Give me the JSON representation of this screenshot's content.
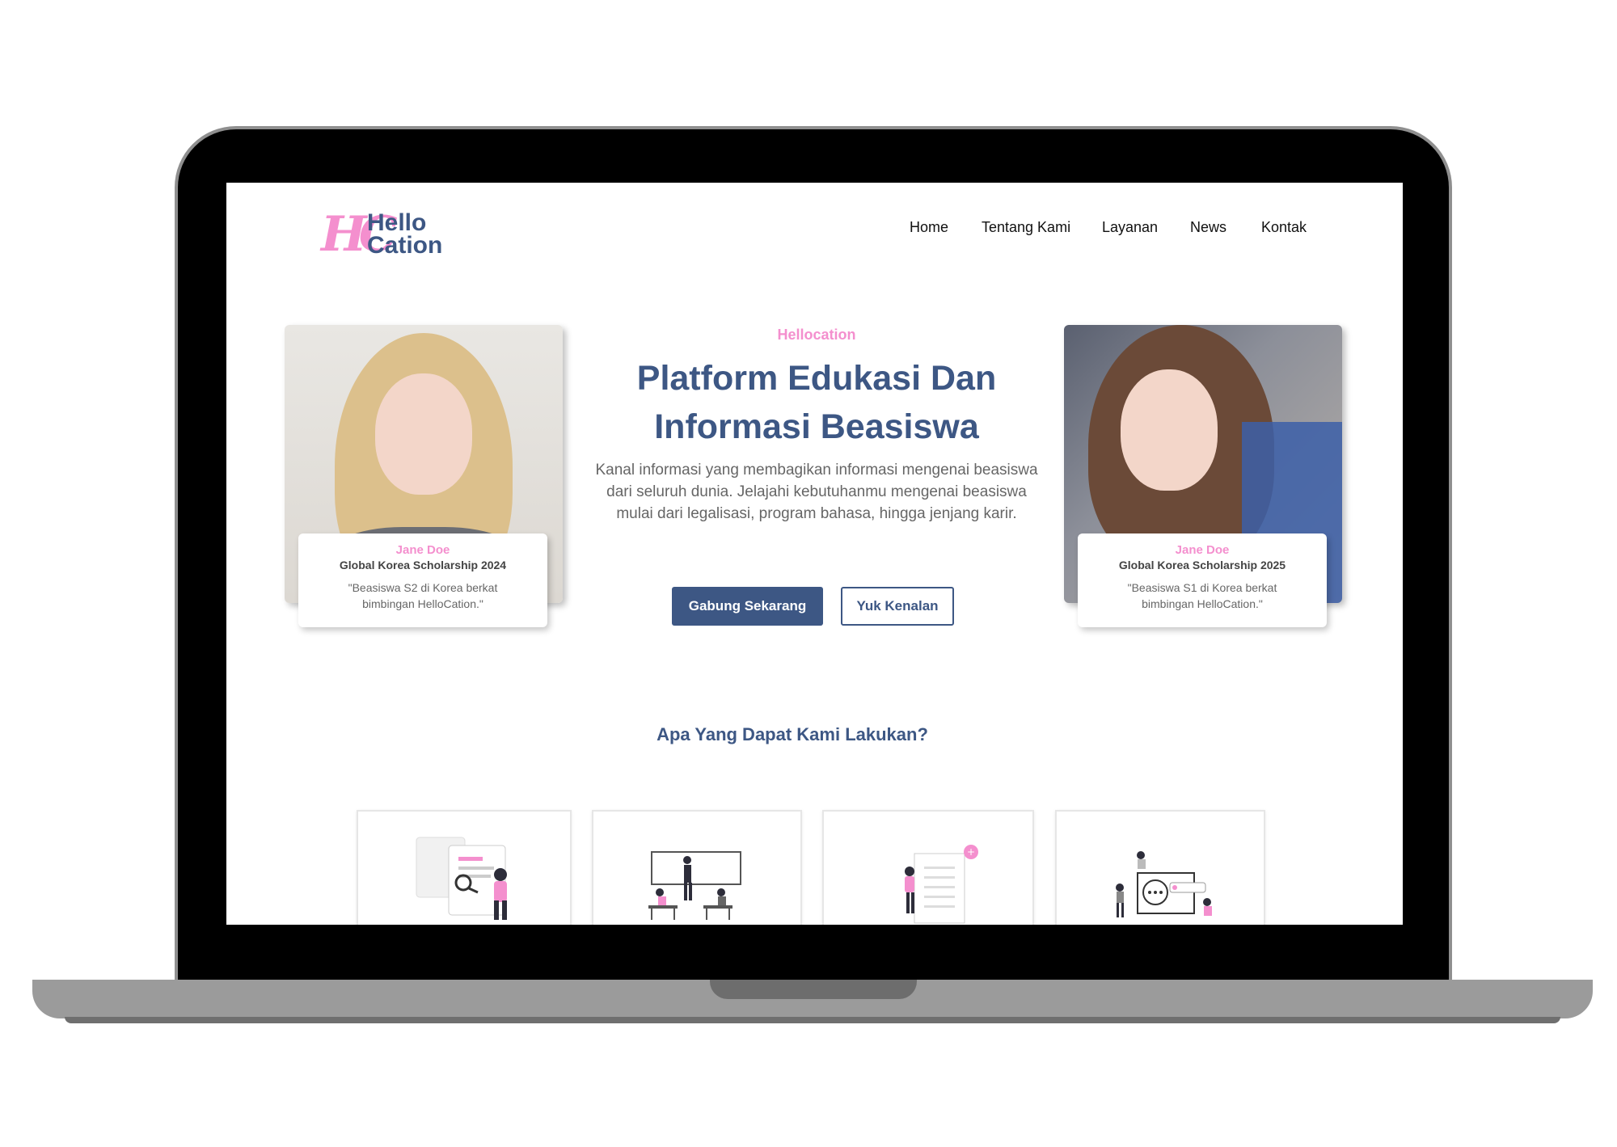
{
  "brand": {
    "mark": "HC",
    "name_line1": "Hello",
    "name_line2": "Cation",
    "pink": "#f48fce",
    "navy": "#3d5784"
  },
  "nav": {
    "items": [
      {
        "label": "Home"
      },
      {
        "label": "Tentang Kami"
      },
      {
        "label": "Layanan"
      },
      {
        "label": "News"
      },
      {
        "label": "Kontak"
      }
    ]
  },
  "hero": {
    "eyebrow": "Hellocation",
    "title": "Platform Edukasi Dan Informasi Beasiswa",
    "description": "Kanal informasi yang membagikan informasi mengenai beasiswa dari seluruh dunia. Jelajahi kebutuhanmu mengenai beasiswa mulai dari legalisasi, program bahasa, hingga jenjang karir.",
    "primary_button": "Gabung Sekarang",
    "secondary_button": "Yuk Kenalan"
  },
  "testimonials": [
    {
      "name": "Jane Doe",
      "program": "Global Korea Scholarship 2024",
      "quote": "\"Beasiswa S2 di Korea berkat bimbingan HelloCation.\""
    },
    {
      "name": "Jane Doe",
      "program": "Global Korea Scholarship 2025",
      "quote": "\"Beasiswa S1 di Korea berkat bimbingan HelloCation.\""
    }
  ],
  "services": {
    "title": "Apa Yang Dapat Kami Lakukan?",
    "cards": [
      {
        "icon": "document-search-illustration"
      },
      {
        "icon": "classroom-illustration"
      },
      {
        "icon": "checklist-illustration"
      },
      {
        "icon": "chat-illustration"
      }
    ]
  }
}
